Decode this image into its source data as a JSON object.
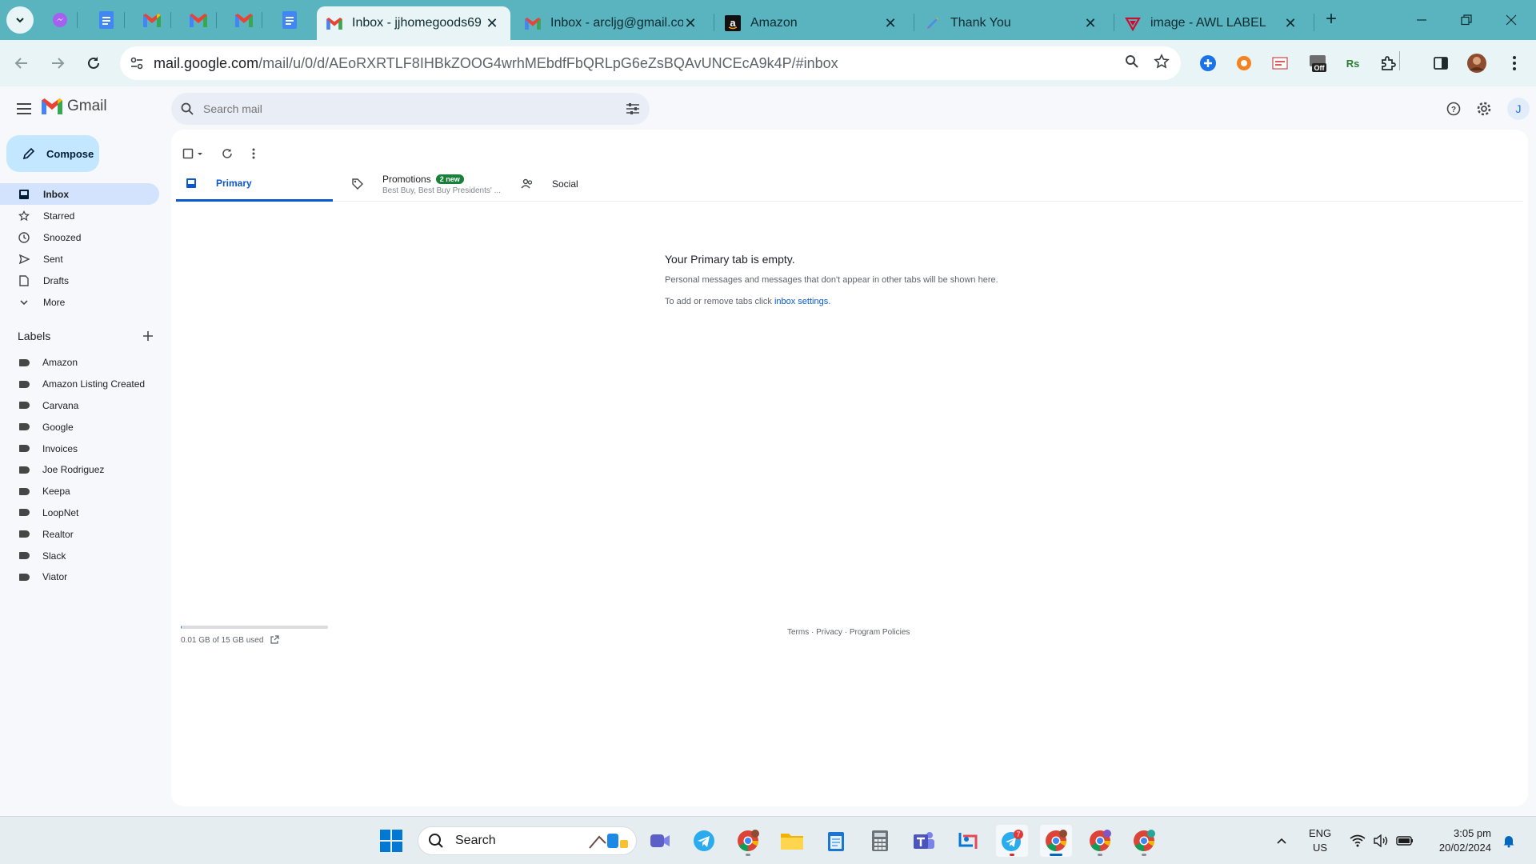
{
  "browser": {
    "tabs": [
      {
        "title": "Inbox - jjhomegoods69",
        "favicon": "gmail-icon",
        "active": true
      },
      {
        "title": "Inbox - arcljg@gmail.com",
        "favicon": "gmail-icon",
        "active": false
      },
      {
        "title": "Amazon",
        "favicon": "amazon-icon",
        "active": false
      },
      {
        "title": "Thank You",
        "favicon": "pen-icon",
        "active": false
      },
      {
        "title": "image - AWL LABEL",
        "favicon": "awl-icon",
        "active": false
      }
    ],
    "url_host": "mail.google.com",
    "url_path": "/mail/u/0/d/AEoRXRTLF8IHBkZOOG4wrhMEbdfFbQRLpG6eZsBQAvUNCEcA9k4P/#inbox",
    "tab_close_glyph": "✕",
    "new_tab_glyph": "+"
  },
  "gmail": {
    "brand": "Gmail",
    "search_placeholder": "Search mail",
    "compose_label": "Compose",
    "avatar_initial": "J",
    "nav": [
      {
        "label": "Inbox",
        "icon": "inbox-icon",
        "active": true
      },
      {
        "label": "Starred",
        "icon": "star-icon",
        "active": false
      },
      {
        "label": "Snoozed",
        "icon": "clock-icon",
        "active": false
      },
      {
        "label": "Sent",
        "icon": "send-icon",
        "active": false
      },
      {
        "label": "Drafts",
        "icon": "draft-icon",
        "active": false
      },
      {
        "label": "More",
        "icon": "chevron-down-icon",
        "active": false
      }
    ],
    "labels_title": "Labels",
    "labels": [
      "Amazon",
      "Amazon Listing Created",
      "Carvana",
      "Google",
      "Invoices",
      "Joe Rodriguez",
      "Keepa",
      "LoopNet",
      "Realtor",
      "Slack",
      "Viator"
    ],
    "inbox_tabs": {
      "primary": "Primary",
      "promotions": "Promotions",
      "promotions_badge": "2 new",
      "promotions_sub": "Best Buy, Best Buy Presidents' ...",
      "social": "Social"
    },
    "empty_state": {
      "title": "Your Primary tab is empty.",
      "line1": "Personal messages and messages that don't appear in other tabs will be shown here.",
      "line2_prefix": "To add or remove tabs click ",
      "line2_link": "inbox settings",
      "line2_suffix": "."
    },
    "storage": {
      "text": "0.01 GB of 15 GB used",
      "used_fraction": 0.001
    },
    "footer": {
      "terms": "Terms",
      "privacy": "Privacy",
      "policies": "Program Policies",
      "sep": " · "
    }
  },
  "taskbar": {
    "search_label": "Search",
    "telegram_badge": "7",
    "lang_line1": "ENG",
    "lang_line2": "US",
    "time": "3:05 pm",
    "date": "20/02/2024"
  },
  "colors": {
    "browser_frame": "#5ab4c0",
    "gmail_accent": "#0b57d0",
    "compose_bg": "#c2e7ff",
    "active_nav_bg": "#d3e3fd",
    "promo_badge": "#188038"
  }
}
